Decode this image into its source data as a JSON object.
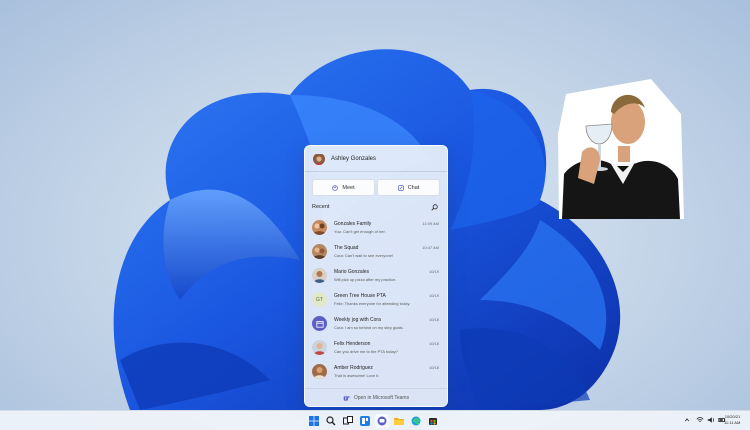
{
  "flyout": {
    "user_name": "Ashley Gonzales",
    "meet_label": "Meet",
    "chat_label": "Chat",
    "recent_label": "Recent",
    "open_teams_label": "Open in Microsoft Teams",
    "conversations": [
      {
        "name": "Gonzales Family",
        "message": "Yuu: Can't get enough of her.",
        "time": "11:09 AM",
        "avatar": "photo"
      },
      {
        "name": "The Squad",
        "message": "Cora: Can't wait to see everyone!",
        "time": "10:47 AM",
        "avatar": "photo"
      },
      {
        "name": "Mario Gonzales",
        "message": "Will pick up pizza after my practice.",
        "time": "10/19",
        "avatar": "photo"
      },
      {
        "name": "Green Tree House PTA",
        "message": "Felix: Thanks everyone for attending today.",
        "time": "10/19",
        "avatar": "GT"
      },
      {
        "name": "Weekly jog with Cora",
        "message": "Cora: I am so behind on my step goals.",
        "time": "10/18",
        "avatar": "calendar"
      },
      {
        "name": "Felix Henderson",
        "message": "Can you drive me to the PTA today?",
        "time": "10/18",
        "avatar": "photo"
      },
      {
        "name": "Amber Rodriguez",
        "message": "That is awesome! Love it.",
        "time": "10/18",
        "avatar": "photo"
      }
    ]
  },
  "taskbar": {
    "clock_date": "10/20/21",
    "clock_time": "11:11 AM",
    "icons": [
      "windows-start-icon",
      "search-icon",
      "task-view-icon",
      "widgets-icon",
      "chat-icon",
      "file-explorer-icon",
      "edge-icon",
      "store-icon"
    ]
  },
  "colors": {
    "accent": "#5b5fc7",
    "bloom": "#1f5fe0"
  }
}
